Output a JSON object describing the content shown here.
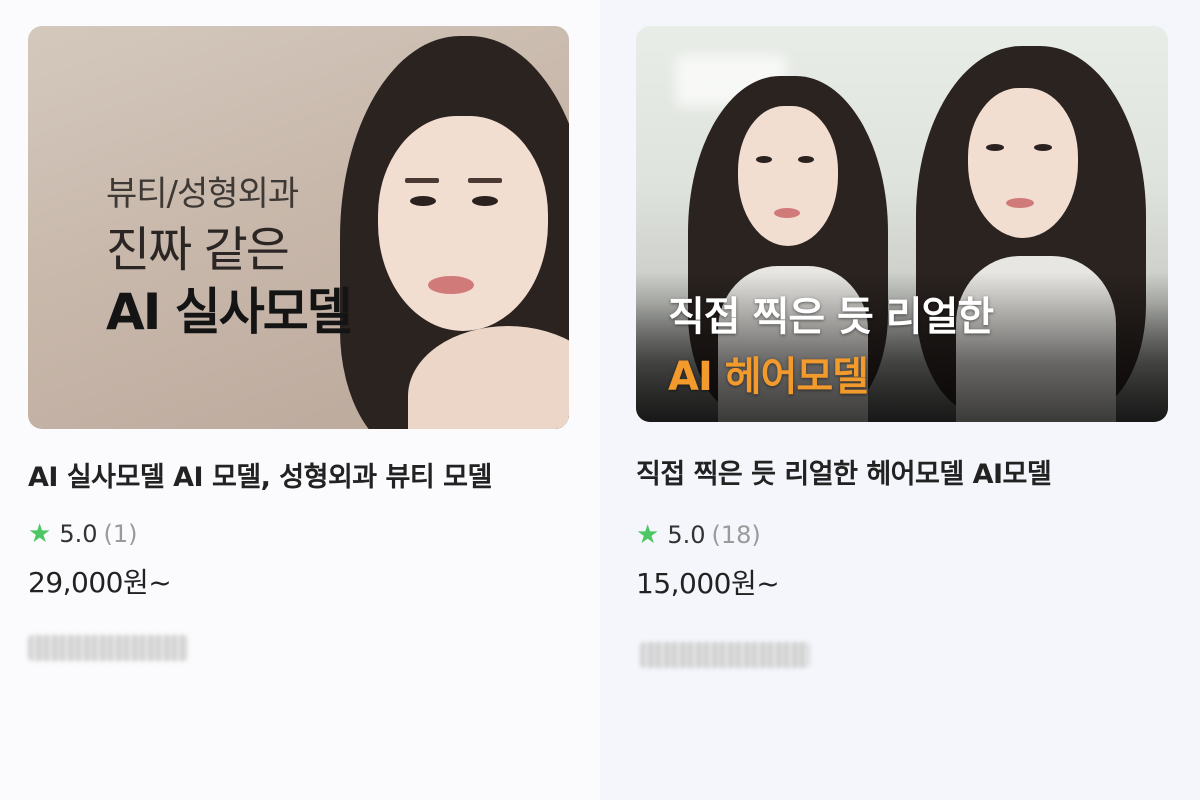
{
  "products": [
    {
      "overlay": {
        "line1": "뷰티/성형외과",
        "line2": "진짜 같은",
        "line3": "AI 실사모델"
      },
      "title": "AI 실사모델 AI 모델, 성형외과 뷰티 모델",
      "rating": {
        "score": "5.0",
        "count": "(1)"
      },
      "price": "29,000원~"
    },
    {
      "overlay": {
        "line1": "직접 찍은 듯 리얼한",
        "line2": "AI 헤어모델"
      },
      "title": "직접 찍은 듯 리얼한 헤어모델 AI모델",
      "rating": {
        "score": "5.0",
        "count": "(18)"
      },
      "price": "15,000원~"
    }
  ],
  "colors": {
    "star": "#4cc764",
    "accent_orange": "#f39a2c",
    "left_bg": "#fbfbfd",
    "right_bg": "#f4f6fb"
  },
  "icons": {
    "rating": "star-icon"
  }
}
